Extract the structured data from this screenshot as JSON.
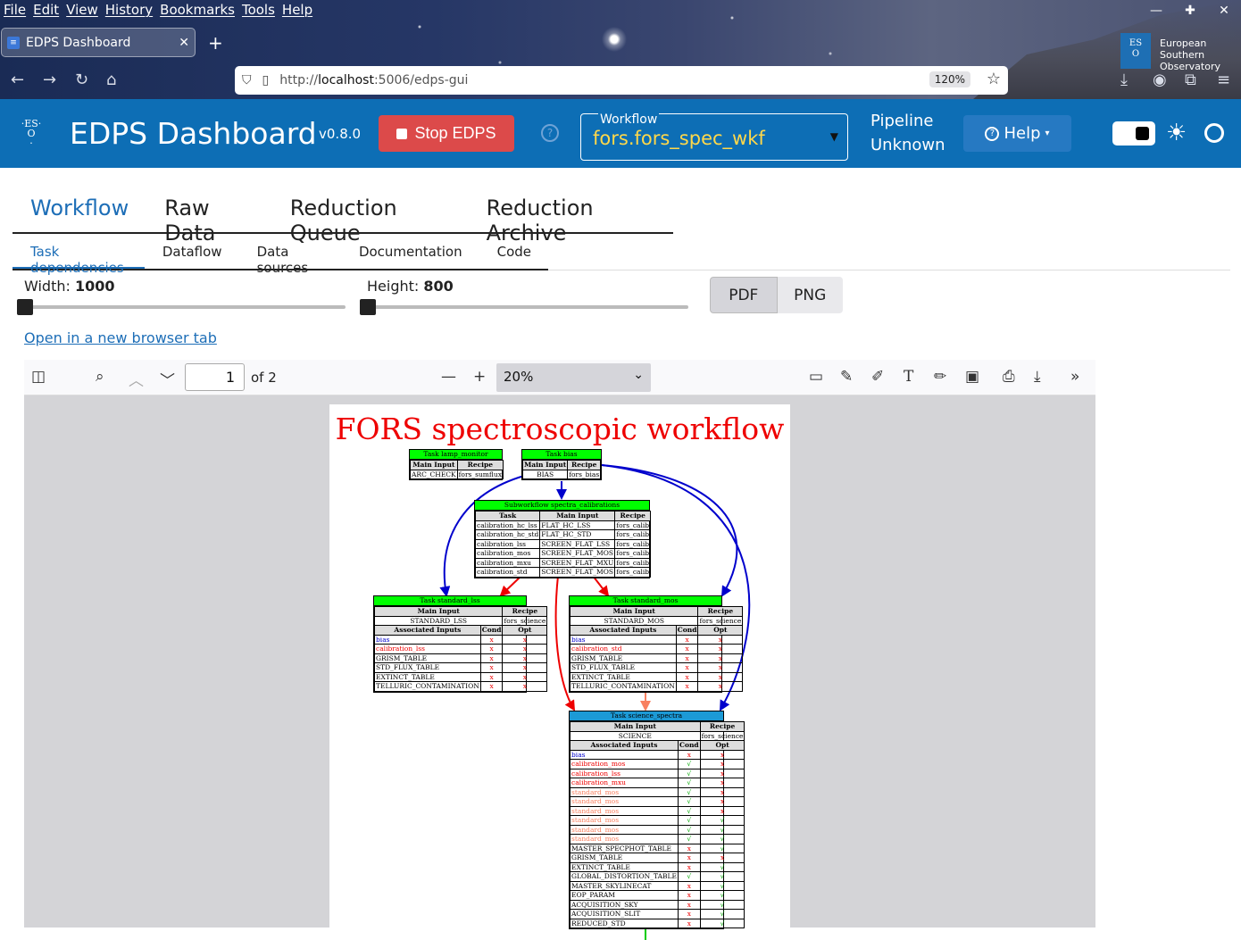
{
  "browser": {
    "menu": [
      "File",
      "Edit",
      "View",
      "History",
      "Bookmarks",
      "Tools",
      "Help"
    ],
    "tab_title": "EDPS Dashboard",
    "url_scheme": "http://",
    "url_host": "localhost",
    "url_rest": ":5006/edps-gui",
    "zoom": "120%",
    "eso_text": [
      "European",
      "Southern",
      "Observatory"
    ]
  },
  "header": {
    "title": "EDPS Dashboard",
    "version": "v0.8.0",
    "stop_label": "Stop EDPS",
    "workflow_label": "Workflow",
    "workflow_value": "fors.fors_spec_wkf",
    "pipeline_line1": "Pipeline",
    "pipeline_line2": "Unknown",
    "help_label": "Help"
  },
  "main_tabs": [
    "Workflow",
    "Raw Data",
    "Reduction Queue",
    "Reduction Archive"
  ],
  "sub_tabs": [
    "Task dependencies",
    "Dataflow",
    "Data sources",
    "Documentation",
    "Code"
  ],
  "controls": {
    "width_label": "Width:",
    "width_value": "1000",
    "height_label": "Height:",
    "height_value": "800",
    "pdf_label": "PDF",
    "png_label": "PNG",
    "open_link": "Open in a new browser tab"
  },
  "viewer": {
    "page": "1",
    "of": "of 2",
    "zoom": "20%"
  },
  "graph": {
    "title": "FORS spectroscopic workflow",
    "lamp": {
      "name": "Task lamp_monitor",
      "h1": "Main Input",
      "h2": "Recipe",
      "c1": "ARC_CHECK",
      "c2": "fors_sumflux"
    },
    "bias": {
      "name": "Task bias",
      "h1": "Main Input",
      "h2": "Recipe",
      "c1": "BIAS",
      "c2": "fors_bias"
    },
    "spectra": {
      "name": "Subworkflow spectra_calibrations",
      "h": [
        "Task",
        "Main Input",
        "Recipe"
      ],
      "rows": [
        [
          "calibration_hc_lss",
          "FLAT_HC_LSS",
          "fors_calib"
        ],
        [
          "calibration_hc_std",
          "FLAT_HC_STD",
          "fors_calib"
        ],
        [
          "calibration_lss",
          "SCREEN_FLAT_LSS",
          "fors_calib"
        ],
        [
          "calibration_mos",
          "SCREEN_FLAT_MOS",
          "fors_calib"
        ],
        [
          "calibration_mxu",
          "SCREEN_FLAT_MXU",
          "fors_calib"
        ],
        [
          "calibration_std",
          "SCREEN_FLAT_MOS",
          "fors_calib"
        ]
      ]
    },
    "std_lss": {
      "name": "Task standard_lss",
      "h1": "Main Input",
      "h2": "Recipe",
      "c1": "STANDARD_LSS",
      "c2": "fors_science",
      "ah": [
        "Associated Inputs",
        "Cond",
        "Opt"
      ],
      "rows": [
        [
          "bias",
          "x",
          "x"
        ],
        [
          "calibration_lss",
          "x",
          "x"
        ],
        [
          "GRISM_TABLE",
          "x",
          "x"
        ],
        [
          "STD_FLUX_TABLE",
          "x",
          "x"
        ],
        [
          "EXTINCT_TABLE",
          "x",
          "x"
        ],
        [
          "TELLURIC_CONTAMINATION",
          "x",
          "x"
        ]
      ]
    },
    "std_mos": {
      "name": "Task standard_mos",
      "h1": "Main Input",
      "h2": "Recipe",
      "c1": "STANDARD_MOS",
      "c2": "fors_science",
      "ah": [
        "Associated Inputs",
        "Cond",
        "Opt"
      ],
      "rows": [
        [
          "bias",
          "x",
          "x"
        ],
        [
          "calibration_std",
          "x",
          "x"
        ],
        [
          "GRISM_TABLE",
          "x",
          "x"
        ],
        [
          "STD_FLUX_TABLE",
          "x",
          "x"
        ],
        [
          "EXTINCT_TABLE",
          "x",
          "x"
        ],
        [
          "TELLURIC_CONTAMINATION",
          "x",
          "x"
        ]
      ]
    },
    "science": {
      "name": "Task science_spectra",
      "h1": "Main Input",
      "h2": "Recipe",
      "c1": "SCIENCE",
      "c2": "fors_science",
      "ah": [
        "Associated Inputs",
        "Cond",
        "Opt"
      ],
      "rows": [
        [
          "bias",
          "x",
          "x"
        ],
        [
          "calibration_mos",
          "√",
          "x"
        ],
        [
          "calibration_lss",
          "√",
          "x"
        ],
        [
          "calibration_mxu",
          "√",
          "x"
        ],
        [
          "standard_mos",
          "√",
          "x"
        ],
        [
          "standard_mos",
          "√",
          "x"
        ],
        [
          "standard_mos",
          "√",
          "x"
        ],
        [
          "standard_mos",
          "√",
          "√"
        ],
        [
          "standard_mos",
          "√",
          "√"
        ],
        [
          "standard_mos",
          "√",
          "√"
        ],
        [
          "MASTER_SPECPHOT_TABLE",
          "x",
          "√"
        ],
        [
          "GRISM_TABLE",
          "x",
          "x"
        ],
        [
          "EXTINCT_TABLE",
          "x",
          "√"
        ],
        [
          "GLOBAL_DISTORTION_TABLE",
          "√",
          "√"
        ],
        [
          "MASTER_SKYLINECAT",
          "x",
          "√"
        ],
        [
          "EOP_PARAM",
          "x",
          "√"
        ],
        [
          "ACQUISITION_SKY",
          "x",
          "√"
        ],
        [
          "ACQUISITION_SLIT",
          "x",
          "√"
        ],
        [
          "REDUCED_STD",
          "x",
          "√"
        ]
      ]
    }
  }
}
